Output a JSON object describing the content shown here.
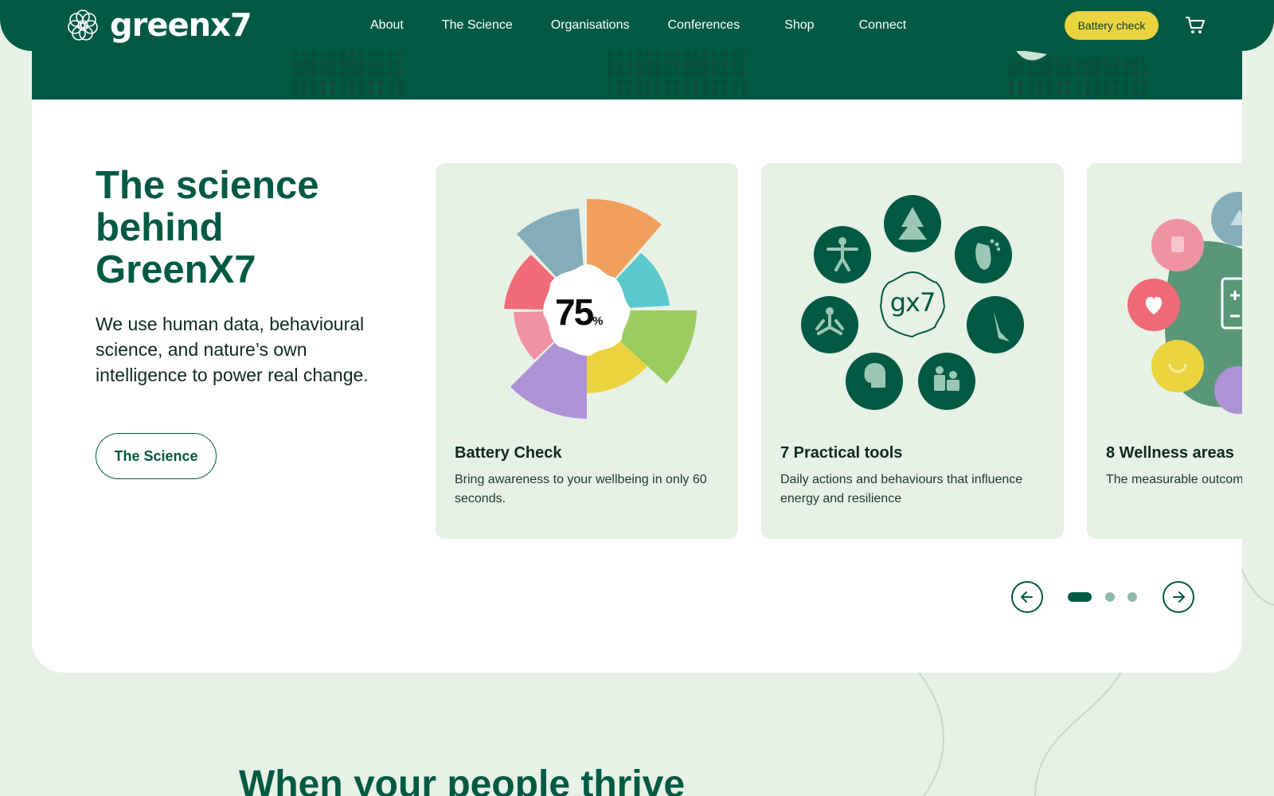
{
  "header": {
    "logo_text": "greenx7",
    "nav": [
      "About",
      "The Science",
      "Organisations",
      "Conferences",
      "Shop",
      "Connect"
    ],
    "cta_label": "Battery check",
    "colors": {
      "brand": "#005a43",
      "accent": "#e9d43f"
    }
  },
  "hero": {
    "title": "The science behind GreenX7",
    "description": "We use human data, behavioural science, and nature’s own intelligence to power real change.",
    "button_label": "The Science"
  },
  "cards": [
    {
      "score_value": "75",
      "score_unit": "%",
      "title": "Battery Check",
      "text": "Bring awareness to your wellbeing in only 60 seconds."
    },
    {
      "center_label": "gx7",
      "title": "7 Practical tools",
      "text": "Daily actions and behaviours that influence energy and resilience"
    },
    {
      "title": "8 Wellness areas",
      "text": "The measurable outcomes"
    }
  ],
  "carousel": {
    "slides": 3,
    "active": 0
  },
  "next_section_heading": "When your people thrive"
}
